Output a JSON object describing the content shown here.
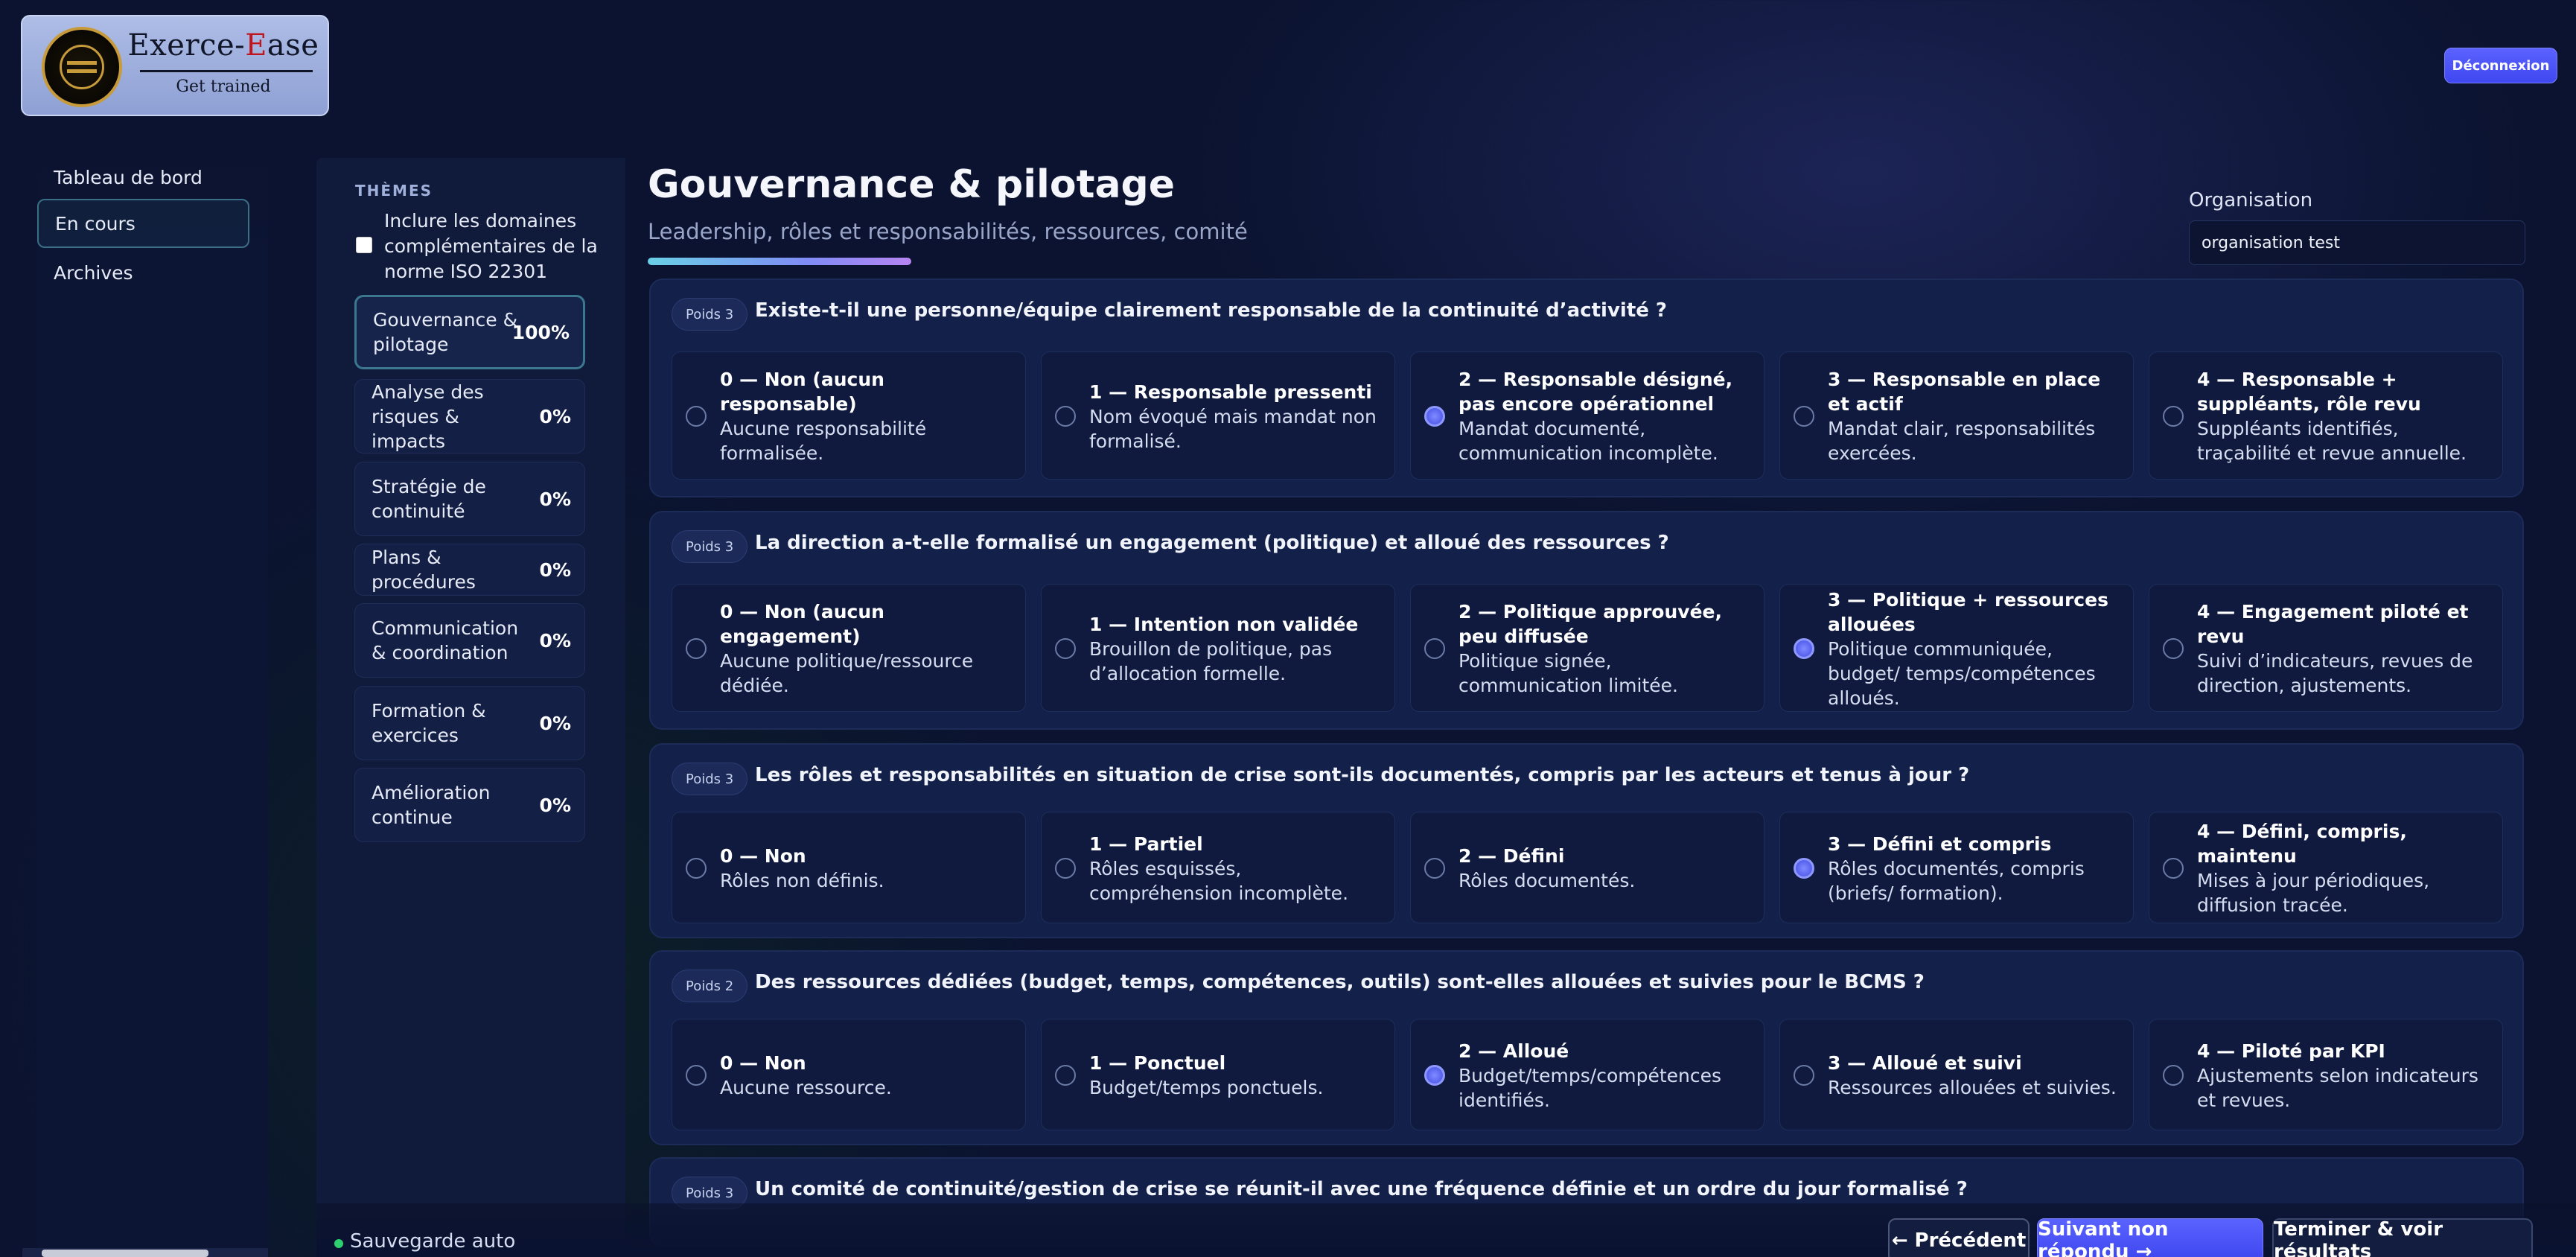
{
  "header": {
    "logo_title_part1": "Exerce-",
    "logo_title_part2": "E",
    "logo_title_part3": "ase",
    "logo_subtitle": "Get trained",
    "logout_label": "Déconnexion"
  },
  "nav": {
    "items": [
      {
        "label": "Tableau de bord"
      },
      {
        "label": "En cours"
      },
      {
        "label": "Archives"
      }
    ]
  },
  "themes": {
    "heading": "THÈMES",
    "include_label": "Inclure les domaines complémentaires de la norme ISO 22301",
    "include_checked": false,
    "items": [
      {
        "label": "Gouvernance & pilotage",
        "pct": "100%"
      },
      {
        "label": "Analyse des risques & impacts",
        "pct": "0%"
      },
      {
        "label": "Stratégie de continuité",
        "pct": "0%"
      },
      {
        "label": "Plans & procédures",
        "pct": "0%"
      },
      {
        "label": "Communication & coordination",
        "pct": "0%"
      },
      {
        "label": "Formation & exercices",
        "pct": "0%"
      },
      {
        "label": "Amélioration continue",
        "pct": "0%"
      }
    ]
  },
  "main": {
    "title": "Gouvernance & pilotage",
    "subtitle": "Leadership, rôles et responsabilités, ressources, comité",
    "org_label": "Organisation",
    "org_value": "organisation test"
  },
  "questions": [
    {
      "badge": "Poids 3",
      "text": "Existe-t-il une personne/équipe clairement responsable de la continuité d’activité ?",
      "selected": 2,
      "options": [
        {
          "title": "0 — Non (aucun responsable)",
          "desc": "Aucune responsabilité formalisée."
        },
        {
          "title": "1 — Responsable pressenti",
          "desc": "Nom évoqué mais mandat non formalisé."
        },
        {
          "title": "2 — Responsable désigné, pas encore opérationnel",
          "desc": "Mandat documenté, communication incomplète."
        },
        {
          "title": "3 — Responsable en place et actif",
          "desc": "Mandat clair, responsabilités exercées."
        },
        {
          "title": "4 — Responsable + suppléants, rôle revu",
          "desc": "Suppléants identifiés, traçabilité et revue annuelle."
        }
      ]
    },
    {
      "badge": "Poids 3",
      "text": "La direction a-t-elle formalisé un engagement (politique) et alloué des ressources ?",
      "selected": 3,
      "options": [
        {
          "title": "0 — Non (aucun engagement)",
          "desc": "Aucune politique/ressource dédiée."
        },
        {
          "title": "1 — Intention non validée",
          "desc": "Brouillon de politique, pas d’allocation formelle."
        },
        {
          "title": "2 — Politique approuvée, peu diffusée",
          "desc": "Politique signée, communication limitée."
        },
        {
          "title": "3 — Politique + ressources allouées",
          "desc": "Politique communiquée, budget/ temps/compétences alloués."
        },
        {
          "title": "4 — Engagement piloté et revu",
          "desc": "Suivi d’indicateurs, revues de direction, ajustements."
        }
      ]
    },
    {
      "badge": "Poids 3",
      "text": "Les rôles et responsabilités en situation de crise sont-ils documentés, compris par les acteurs et tenus à jour ?",
      "selected": 3,
      "options": [
        {
          "title": "0 — Non",
          "desc": "Rôles non définis."
        },
        {
          "title": "1 — Partiel",
          "desc": "Rôles esquissés, compréhension incomplète."
        },
        {
          "title": "2 — Défini",
          "desc": "Rôles documentés."
        },
        {
          "title": "3 — Défini et compris",
          "desc": "Rôles documentés, compris (briefs/ formation)."
        },
        {
          "title": "4 — Défini, compris, maintenu",
          "desc": "Mises à jour périodiques, diffusion tracée."
        }
      ]
    },
    {
      "badge": "Poids 2",
      "text": "Des ressources dédiées (budget, temps, compétences, outils) sont-elles allouées et suivies pour le BCMS ?",
      "selected": 2,
      "options": [
        {
          "title": "0 — Non",
          "desc": "Aucune ressource."
        },
        {
          "title": "1 — Ponctuel",
          "desc": "Budget/temps ponctuels."
        },
        {
          "title": "2 — Alloué",
          "desc": "Budget/temps/compétences identifiés."
        },
        {
          "title": "3 — Alloué et suivi",
          "desc": "Ressources allouées et suivies."
        },
        {
          "title": "4 — Piloté par KPI",
          "desc": "Ajustements selon indicateurs et revues."
        }
      ]
    },
    {
      "badge": "Poids 3",
      "text": "Un comité de continuité/gestion de crise se réunit-il avec une fréquence définie et un ordre du jour formalisé ?",
      "selected": -1,
      "options": []
    }
  ],
  "footer": {
    "autosave": "Sauvegarde auto",
    "prev_label": "← Précédent",
    "next_label": "Suivant non répondu →",
    "finish_label": "Terminer & voir résultats"
  },
  "colors": {
    "background": "#0b1330",
    "accent": "#4a52f5",
    "panel": "#12204a",
    "autosave_dot": "#2ecf6e"
  }
}
